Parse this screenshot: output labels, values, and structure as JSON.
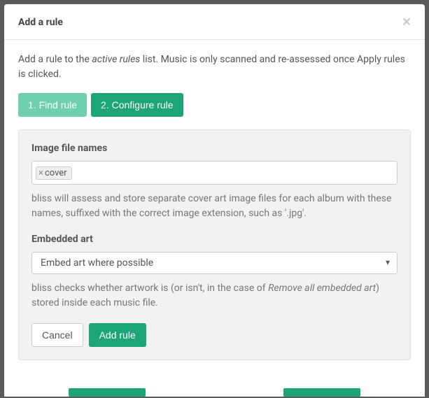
{
  "modal": {
    "title": "Add a rule",
    "intro_pre": "Add a rule to the ",
    "intro_em": "active rules",
    "intro_post": " list. Music is only scanned and re-assessed once Apply rules is clicked."
  },
  "steps": {
    "find": "1. Find rule",
    "configure": "2. Configure rule"
  },
  "image_section": {
    "label": "Image file names",
    "tag": "cover",
    "help": "bliss will assess and store separate cover art image files for each album with these names, suffixed with the correct image extension, such as '.jpg'."
  },
  "embedded_section": {
    "label": "Embedded art",
    "selected": "Embed art where possible",
    "help_pre": "bliss checks whether artwork is (or isn't, in the case of ",
    "help_em": "Remove all embedded art",
    "help_post": ") stored inside each music file."
  },
  "actions": {
    "cancel": "Cancel",
    "add": "Add rule"
  }
}
